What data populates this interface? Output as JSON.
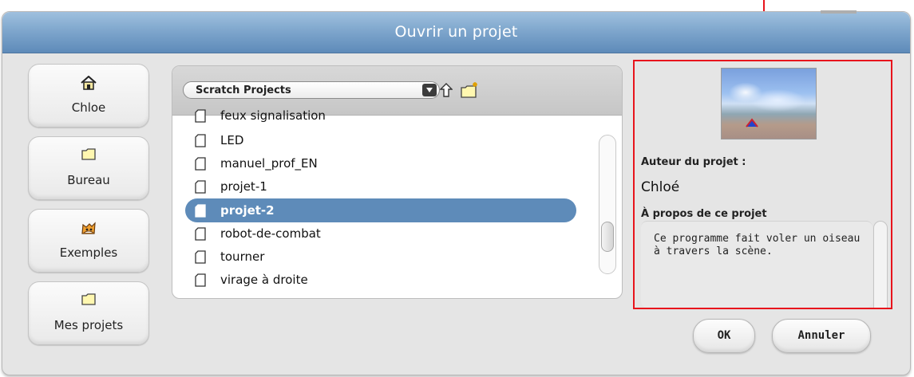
{
  "dialog": {
    "title": "Ouvrir un projet"
  },
  "shortcuts": [
    {
      "label": "Chloe",
      "icon": "home-icon"
    },
    {
      "label": "Bureau",
      "icon": "folder-icon"
    },
    {
      "label": "Exemples",
      "icon": "scratch-cat-icon"
    },
    {
      "label": "Mes projets",
      "icon": "folder-icon"
    }
  ],
  "browser": {
    "folder": "Scratch Projects",
    "files": [
      {
        "name": "feux signalisation",
        "selected": false,
        "partially_visible": true
      },
      {
        "name": "LED",
        "selected": false
      },
      {
        "name": "manuel_prof_EN",
        "selected": false
      },
      {
        "name": "projet-1",
        "selected": false
      },
      {
        "name": "projet-2",
        "selected": true
      },
      {
        "name": "robot-de-combat",
        "selected": false
      },
      {
        "name": "tourner",
        "selected": false
      },
      {
        "name": "virage à droite",
        "selected": false
      }
    ]
  },
  "info": {
    "author_label": "Auteur du projet :",
    "author": "Chloé",
    "about_label": "À propos de ce projet",
    "notes": "Ce programme fait voler un oiseau à travers la scène."
  },
  "buttons": {
    "ok": "OK",
    "cancel": "Annuler"
  },
  "colors": {
    "title_bar": "#7fa7cd",
    "selection": "#5e8bb9",
    "highlight_box": "#e8141c",
    "dialog_bg": "#e5e5e5"
  }
}
